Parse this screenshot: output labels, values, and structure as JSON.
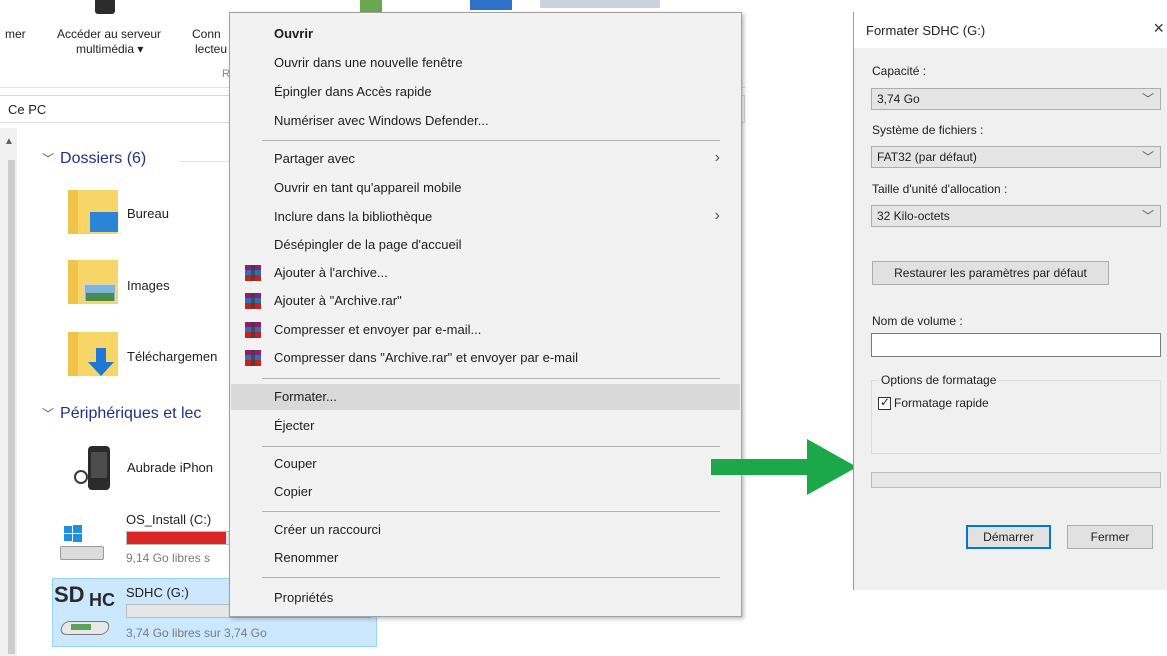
{
  "explorer": {
    "ribbon": {
      "partial_left": "mer",
      "media_server_line1": "Accéder au serveur",
      "media_server_line2": "multimédia ▾",
      "connect_line1": "Conn",
      "connect_line2": "lecteu",
      "group_partial": "R"
    },
    "address": {
      "path": "Ce PC"
    },
    "folders": {
      "heading": "Dossiers (6)",
      "items": [
        {
          "label": "Bureau"
        },
        {
          "label": "Images"
        },
        {
          "label": "Téléchargemen"
        }
      ]
    },
    "devices": {
      "heading": "Périphériques et lec",
      "items": [
        {
          "label": "Aubrade iPhon"
        },
        {
          "label": "OS_Install (C:)",
          "free": "9,14 Go libres s",
          "usage": 0.92,
          "bar_color": "#da2626"
        },
        {
          "label": "SDHC (G:)",
          "free": "3,74 Go libres sur 3,74 Go",
          "usage": 0.0,
          "bar_color": "#26a0da",
          "logo_sd": "SD",
          "logo_hc": "HC"
        }
      ]
    }
  },
  "context_menu": {
    "items": [
      {
        "label": "Ouvrir",
        "bold": true
      },
      {
        "label": "Ouvrir dans une nouvelle fenêtre"
      },
      {
        "label": "Épingler dans Accès rapide"
      },
      {
        "label": "Numériser avec Windows Defender..."
      },
      {
        "label": "Partager avec",
        "submenu": "›"
      },
      {
        "label": "Ouvrir en tant qu'appareil mobile"
      },
      {
        "label": "Inclure dans la bibliothèque",
        "submenu": "›"
      },
      {
        "label": "Désépingler de la page d'accueil"
      },
      {
        "label": "Ajouter à l'archive...",
        "icon": "winrar-icon"
      },
      {
        "label": "Ajouter à \"Archive.rar\"",
        "icon": "winrar-icon"
      },
      {
        "label": "Compresser et envoyer par e-mail...",
        "icon": "winrar-icon"
      },
      {
        "label": "Compresser dans \"Archive.rar\" et envoyer par e-mail",
        "icon": "winrar-icon"
      },
      {
        "label": "Formater...",
        "highlighted": true
      },
      {
        "label": "Éjecter"
      },
      {
        "label": "Couper"
      },
      {
        "label": "Copier"
      },
      {
        "label": "Créer un raccourci"
      },
      {
        "label": "Renommer"
      },
      {
        "label": "Propriétés"
      }
    ]
  },
  "arrow": {
    "color": "#1aa84a"
  },
  "format_dialog": {
    "title": "Formater SDHC (G:)",
    "close_glyph": "×",
    "capacity_label": "Capacité :",
    "capacity_value": "3,74 Go",
    "filesystem_label": "Système de fichiers :",
    "filesystem_value": "FAT32 (par défaut)",
    "alloc_label": "Taille d'unité d'allocation :",
    "alloc_value": "32 Kilo-octets",
    "dropdown_glyph": "﹀",
    "restore_button": "Restaurer les paramètres par défaut",
    "volume_label": "Nom de volume :",
    "volume_value": "",
    "options_legend": "Options de formatage",
    "quick_format_label": "Formatage rapide",
    "quick_format_checked": true,
    "check_glyph": "✓",
    "progress": 0,
    "start_button": "Démarrer",
    "close_button": "Fermer"
  }
}
